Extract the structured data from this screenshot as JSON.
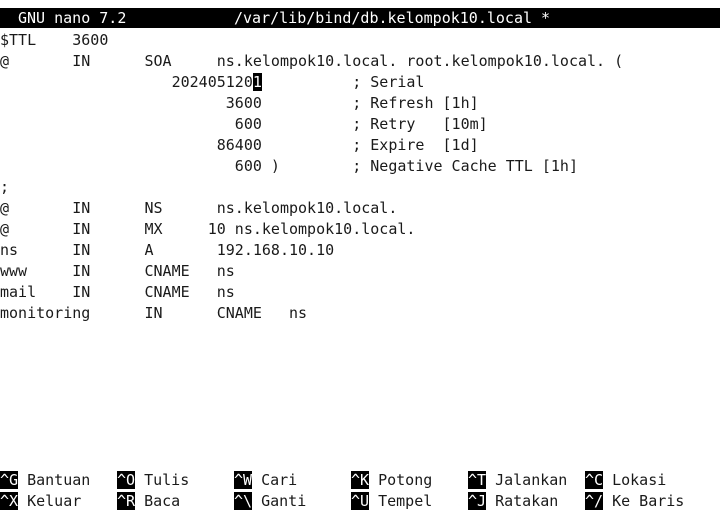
{
  "title_bar": {
    "app": "GNU nano 7.2",
    "file": "/var/lib/bind/db.kelompok10.local *"
  },
  "editor": {
    "lines": [
      "$TTL    3600",
      "@       IN      SOA     ns.kelompok10.local. root.kelompok10.local. (",
      "                   2024051201          ; Serial",
      "                         3600          ; Refresh [1h]",
      "                          600          ; Retry   [10m]",
      "                        86400          ; Expire  [1d]",
      "                          600 )        ; Negative Cache TTL [1h]",
      ";",
      "@       IN      NS      ns.kelompok10.local.",
      "@       IN      MX     10 ns.kelompok10.local.",
      "ns      IN      A       192.168.10.10",
      "www     IN      CNAME   ns",
      "mail    IN      CNAME   ns",
      "monitoring      IN      CNAME   ns"
    ],
    "cursor_line": {
      "before": "                   202405120",
      "cursor_char": "1",
      "after": "          ; Serial"
    }
  },
  "shortcuts": {
    "row1": [
      {
        "key": "^G",
        "label": "Bantuan"
      },
      {
        "key": "^O",
        "label": "Tulis"
      },
      {
        "key": "^W",
        "label": "Cari"
      },
      {
        "key": "^K",
        "label": "Potong"
      },
      {
        "key": "^T",
        "label": "Jalankan"
      },
      {
        "key": "^C",
        "label": "Lokasi"
      }
    ],
    "row2": [
      {
        "key": "^X",
        "label": "Keluar"
      },
      {
        "key": "^R",
        "label": "Baca"
      },
      {
        "key": "^\\",
        "label": "Ganti"
      },
      {
        "key": "^U",
        "label": "Tempel"
      },
      {
        "key": "^J",
        "label": "Ratakan"
      },
      {
        "key": "^/",
        "label": "Ke Baris"
      }
    ]
  }
}
